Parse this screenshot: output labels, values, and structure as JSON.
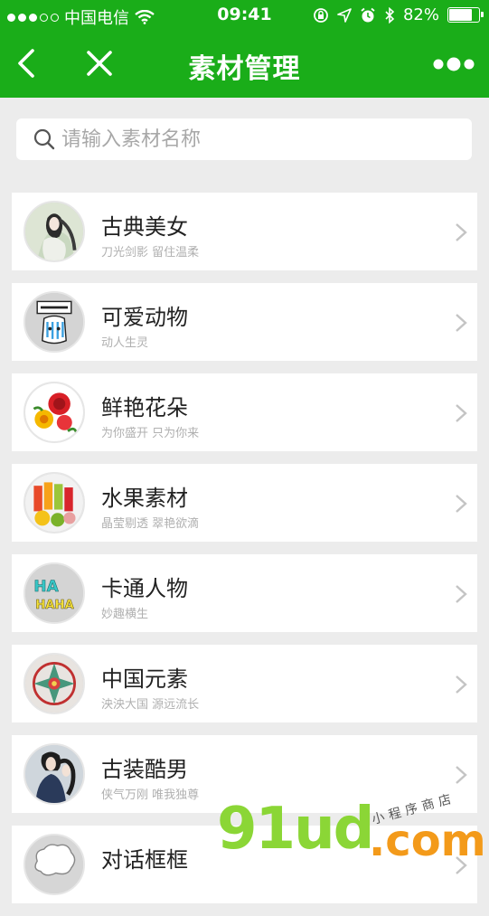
{
  "status_bar": {
    "carrier": "中国电信",
    "time": "09:41",
    "battery": "82%",
    "battery_level": 0.82
  },
  "nav": {
    "title": "素材管理"
  },
  "search": {
    "placeholder": "请输入素材名称"
  },
  "items": [
    {
      "title": "古典美女",
      "subtitle": "刀光剑影 留住温柔",
      "icon": "classical-beauty-thumb"
    },
    {
      "title": "可爱动物",
      "subtitle": "动人生灵",
      "icon": "cute-animal-thumb"
    },
    {
      "title": "鲜艳花朵",
      "subtitle": "为你盛开 只为你来",
      "icon": "flower-thumb"
    },
    {
      "title": "水果素材",
      "subtitle": "晶莹剔透 翠艳欲滴",
      "icon": "fruit-thumb"
    },
    {
      "title": "卡通人物",
      "subtitle": "妙趣横生",
      "icon": "cartoon-thumb"
    },
    {
      "title": "中国元素",
      "subtitle": "泱泱大国 源远流长",
      "icon": "chinese-pattern-thumb"
    },
    {
      "title": "古装酷男",
      "subtitle": "侠气万刚 唯我独尊",
      "icon": "costume-man-thumb"
    },
    {
      "title": "对话框框",
      "subtitle": "",
      "icon": "speech-bubble-thumb"
    }
  ],
  "watermark": {
    "main": "91ud",
    "suffix": ".com",
    "tagline": "小程序商店"
  },
  "colors": {
    "header": "#1aad19",
    "background": "#ececec"
  }
}
